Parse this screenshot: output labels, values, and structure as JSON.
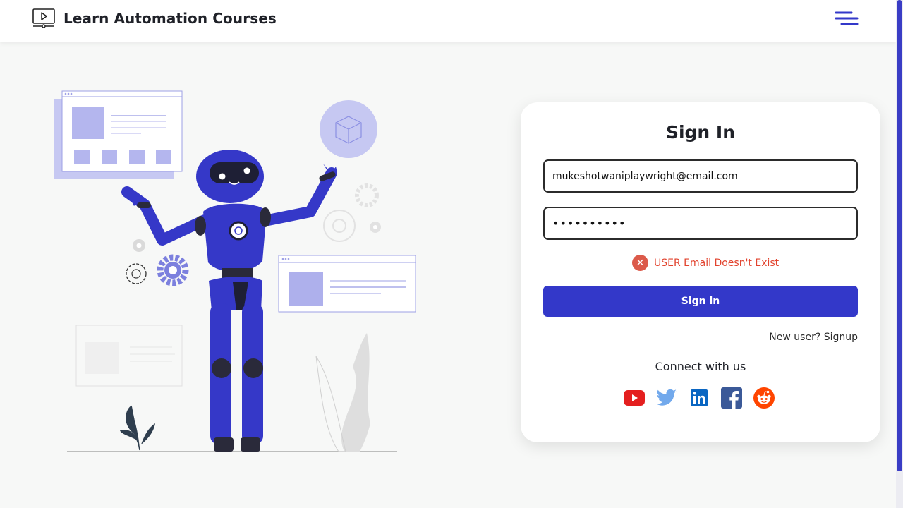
{
  "header": {
    "brand_title": "Learn Automation Courses",
    "brand_icon": "video-player-icon",
    "menu_icon": "hamburger-menu-icon"
  },
  "signin": {
    "title": "Sign In",
    "email_value": "mukeshotwaniplaywright@email.com",
    "password_value": "••••••••••",
    "error_message": "USER Email Doesn't Exist",
    "button_label": "Sign in",
    "signup_link": "New user? Signup",
    "connect_label": "Connect with us"
  },
  "socials": [
    "youtube-icon",
    "twitter-icon",
    "linkedin-icon",
    "facebook-icon",
    "reddit-icon"
  ],
  "colors": {
    "accent": "#3338c9",
    "error": "#e2432e",
    "robot": "#3538c8",
    "robot_light": "#b6b9ef"
  }
}
